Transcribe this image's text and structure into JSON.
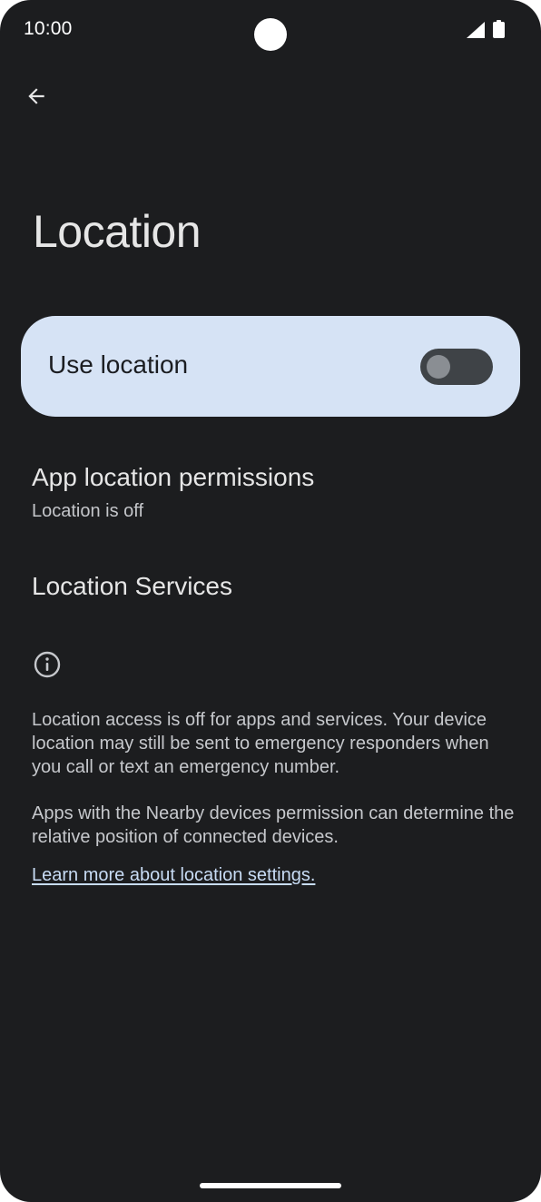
{
  "status_bar": {
    "time": "10:00",
    "icons": [
      "signal-icon",
      "battery-icon"
    ]
  },
  "toolbar": {
    "back_icon": "arrow-back-icon"
  },
  "page": {
    "title": "Location"
  },
  "main_switch": {
    "label": "Use location",
    "checked": false
  },
  "preferences": [
    {
      "title": "App location permissions",
      "summary": "Location is off"
    },
    {
      "title": "Location Services"
    }
  ],
  "footer": {
    "icon": "info-icon",
    "paragraphs": [
      "Location access is off for apps and services. Your device location may still be sent to emergency responders when you call or text an emergency number.",
      "Apps with the Nearby devices permission can determine the relative position of connected devices."
    ],
    "link": "Learn more about location settings."
  },
  "colors": {
    "background": "#1c1d1f",
    "switch_card": "#d6e3f5",
    "toggle_track_off": "#3f4347",
    "toggle_thumb_off": "#8a8e93",
    "link": "#c8dcf5"
  }
}
